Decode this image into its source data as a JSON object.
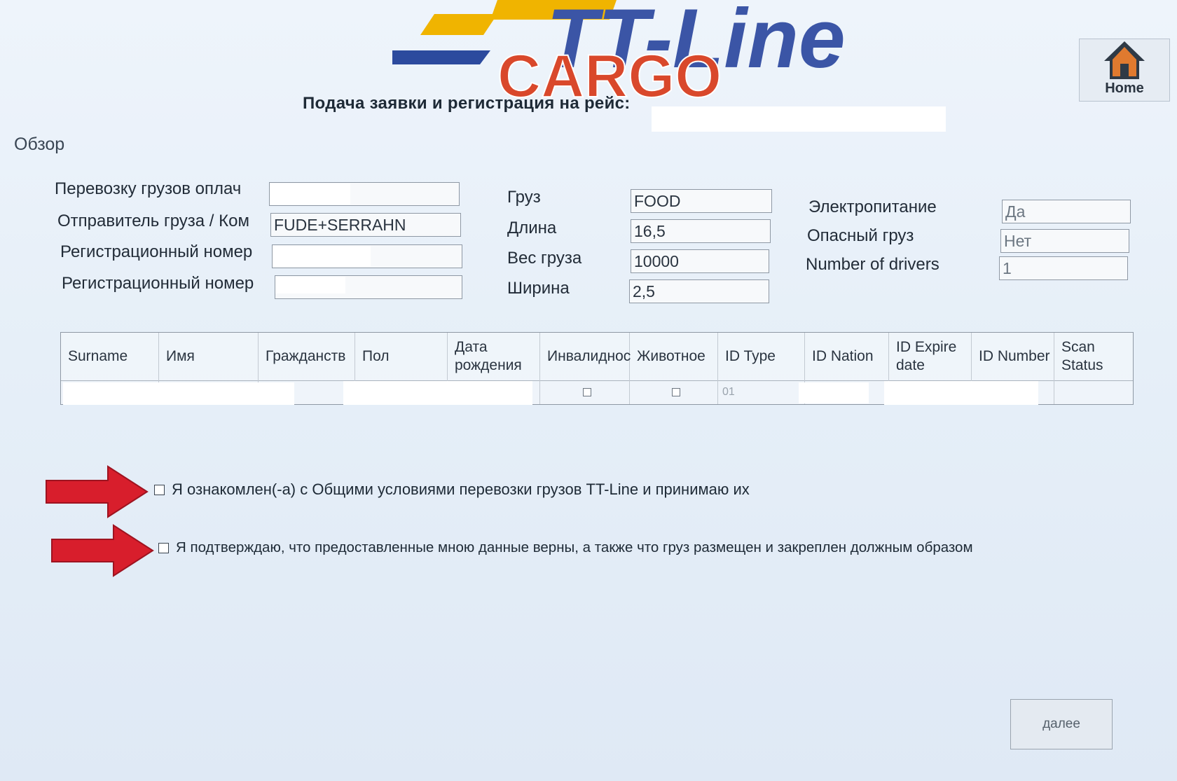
{
  "header": {
    "logo_text_top": "TT-Line",
    "logo_text_bottom": "CARGO",
    "page_heading": "Подача заявки и регистрация на рейс:",
    "home_label": "Home"
  },
  "section_title": "Обзор",
  "form": {
    "left": [
      {
        "label": "Перевозку грузов оплач",
        "value": ""
      },
      {
        "label": "Отправитель груза / Ком",
        "value": "FUDE+SERRAHN"
      },
      {
        "label": "Регистрационный номер",
        "value": ""
      },
      {
        "label": "Регистрационный номер",
        "value": ""
      }
    ],
    "middle": [
      {
        "label": "Груз",
        "value": "FOOD"
      },
      {
        "label": "Длина",
        "value": "16,5"
      },
      {
        "label": "Вес груза",
        "value": "10000"
      },
      {
        "label": "Ширина",
        "value": "2,5"
      }
    ],
    "right": [
      {
        "label": "Электропитание",
        "value": "Да"
      },
      {
        "label": "Опасный груз",
        "value": "Нет"
      },
      {
        "label": "Number of drivers",
        "value": "1"
      }
    ]
  },
  "drivers_table": {
    "columns": [
      "Surname",
      "Имя",
      "Гражданств",
      "Пол",
      "Дата рождения",
      "Инвалиднос",
      "Животное",
      "ID Type",
      "ID Nation",
      "ID Expire date",
      "ID Number",
      "Scan Status"
    ],
    "row": {
      "id_type": "01"
    }
  },
  "agreements": [
    "Я ознакомлен(-а) с Общими условиями перевозки грузов TT-Line и принимаю их",
    "Я подтверждаю, что предоставленные мною данные верны, а также что груз размещен и закреплен должным образом"
  ],
  "next_button": "далее",
  "colors": {
    "logo_blue": "#3b55a6",
    "logo_yellow": "#f0b400",
    "logo_red": "#d9482b",
    "arrow_red": "#d81e2c"
  }
}
